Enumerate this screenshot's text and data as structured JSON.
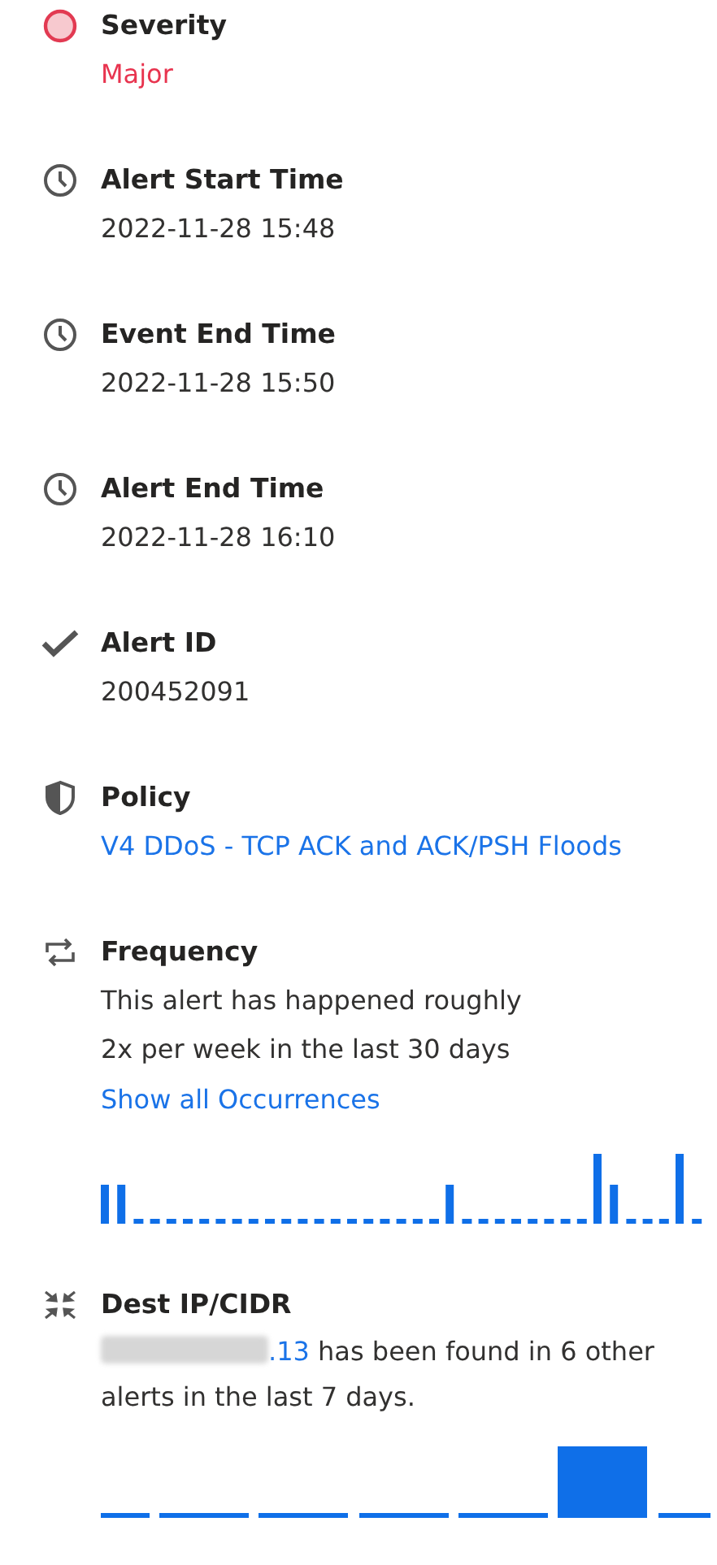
{
  "fields": [
    {
      "kind": "severity",
      "label": "Severity",
      "value": "Major"
    },
    {
      "kind": "time",
      "label": "Alert Start Time",
      "value": "2022-11-28 15:48"
    },
    {
      "kind": "time",
      "label": "Event End Time",
      "value": "2022-11-28 15:50"
    },
    {
      "kind": "time",
      "label": "Alert End Time",
      "value": "2022-11-28 16:10"
    },
    {
      "kind": "id",
      "label": "Alert ID",
      "value": "200452091"
    },
    {
      "kind": "policy",
      "label": "Policy",
      "link": "V4 DDoS - TCP ACK and ACK/PSH Floods"
    },
    {
      "kind": "frequency",
      "label": "Frequency",
      "text": "This alert has happened roughly 2x per week in the last 30 days",
      "link": "Show all Occurrences"
    },
    {
      "kind": "dest",
      "label": "Dest IP/CIDR",
      "link": ".13",
      "text": "has been found in 6 other alerts in the last 7 days."
    }
  ]
}
